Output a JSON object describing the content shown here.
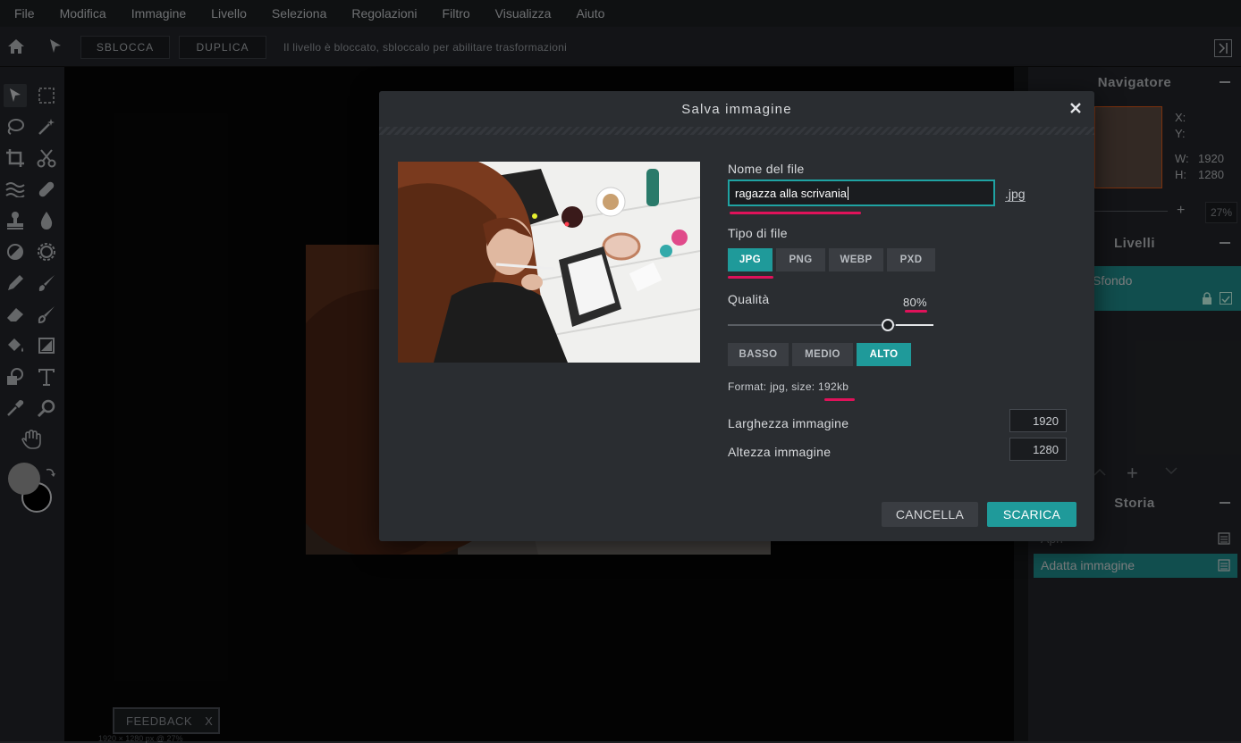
{
  "menu": [
    "File",
    "Modifica",
    "Immagine",
    "Livello",
    "Seleziona",
    "Regolazioni",
    "Filtro",
    "Visualizza",
    "Aiuto"
  ],
  "toolbar": {
    "unlock_label": "SBLOCCA",
    "duplicate_label": "DUPLICA",
    "message": "Il livello è bloccato, sbloccalo per abilitare trasformazioni"
  },
  "navigator": {
    "title": "Navigatore",
    "x_label": "X:",
    "y_label": "Y:",
    "w_label": "W:",
    "w_value": "1920",
    "h_label": "H:",
    "h_value": "1280",
    "zoom": "27%"
  },
  "layers": {
    "title": "Livelli",
    "layer_name": "Sfondo"
  },
  "history": {
    "title": "Storia",
    "items": [
      "Apri",
      "Adatta immagine"
    ]
  },
  "dialog": {
    "title": "Salva immagine",
    "filename_label": "Nome del file",
    "filename_value": "ragazza alla scrivania",
    "extension": ".jpg",
    "filetype_label": "Tipo di file",
    "filetypes": [
      "JPG",
      "PNG",
      "WEBP",
      "PXD"
    ],
    "filetype_selected": "JPG",
    "quality_label": "Qualità",
    "quality_value": "80%",
    "quality_level": 0.8,
    "presets": [
      "BASSO",
      "MEDIO",
      "ALTO"
    ],
    "preset_selected": "ALTO",
    "format_info": "Format: jpg, size: 192kb",
    "width_label": "Larghezza immagine",
    "width_value": "1920",
    "height_label": "Altezza immagine",
    "height_value": "1280",
    "cancel_label": "CANCELLA",
    "download_label": "SCARICA"
  },
  "feedback": {
    "label": "FEEDBACK",
    "close": "X"
  },
  "status": "1920 × 1280 px @ 27%",
  "colors": {
    "accent": "#1f9a9a",
    "highlight_underline": "#e0125a",
    "dialog_bg": "#2a2d31",
    "app_bg": "#1d1f22"
  }
}
